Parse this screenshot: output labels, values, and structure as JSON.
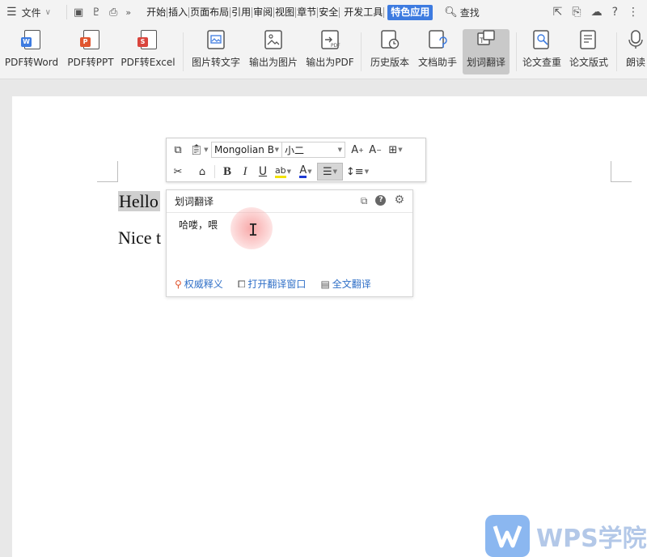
{
  "menu": {
    "file_label": "文件",
    "tabs": [
      "开始",
      "插入",
      "页面布局",
      "引用",
      "审阅",
      "视图",
      "章节",
      "安全",
      "开发工具"
    ],
    "active_tab": "特色应用",
    "search_label": "查找"
  },
  "ribbon": {
    "buttons": [
      {
        "label": "PDF转Word",
        "badge": "W",
        "color": "#3d7be0"
      },
      {
        "label": "PDF转PPT",
        "badge": "P",
        "color": "#e0552f"
      },
      {
        "label": "PDF转Excel",
        "badge": "S",
        "color": "#d9453d"
      },
      {
        "label": "图片转文字"
      },
      {
        "label": "输出为图片"
      },
      {
        "label": "输出为PDF"
      },
      {
        "label": "历史版本"
      },
      {
        "label": "文档助手"
      },
      {
        "label": "划词翻译"
      },
      {
        "label": "论文查重"
      },
      {
        "label": "论文版式"
      },
      {
        "label": "朗读"
      }
    ],
    "active": "划词翻译"
  },
  "document": {
    "line1_selected": "Hello",
    "line2_start": "Nice t"
  },
  "mini_toolbar": {
    "font_name": "Mongolian B",
    "font_size": "小二"
  },
  "translation": {
    "title": "划词翻译",
    "result": "哈喽，喂",
    "links": [
      "权威释义",
      "打开翻译窗口",
      "全文翻译"
    ]
  },
  "watermark": {
    "text": "WPS学院"
  }
}
